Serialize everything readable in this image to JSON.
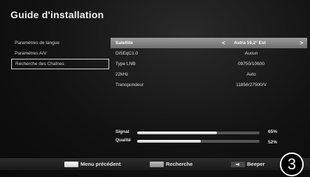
{
  "title": "Guide d'installation",
  "menu": {
    "items": [
      {
        "label": "Paramètres de langue"
      },
      {
        "label": "Paramètres A/V"
      },
      {
        "label": "Recherche des Chaînes"
      }
    ]
  },
  "settings": {
    "rows": [
      {
        "label": "Satellite",
        "value": "Astra 19,2° Est"
      },
      {
        "label": "DiSEqC1.0",
        "value": "Aucun"
      },
      {
        "label": "Type LNB",
        "value": "09750/10600"
      },
      {
        "label": "22kHz",
        "value": "Auto"
      },
      {
        "label": "Transpondeur",
        "value": "11856/27500/V"
      }
    ],
    "arrow_left": "<",
    "arrow_right": ">"
  },
  "signal": {
    "label": "Signal",
    "percent_text": "65%",
    "level": 0.65
  },
  "quality": {
    "label": "Qualité",
    "percent_text": "52%",
    "level": 0.52
  },
  "bottom_bar": {
    "prev_menu": "Menu précédent",
    "search": "Recherche",
    "beeper": "Beeper"
  },
  "step_badge": "3"
}
